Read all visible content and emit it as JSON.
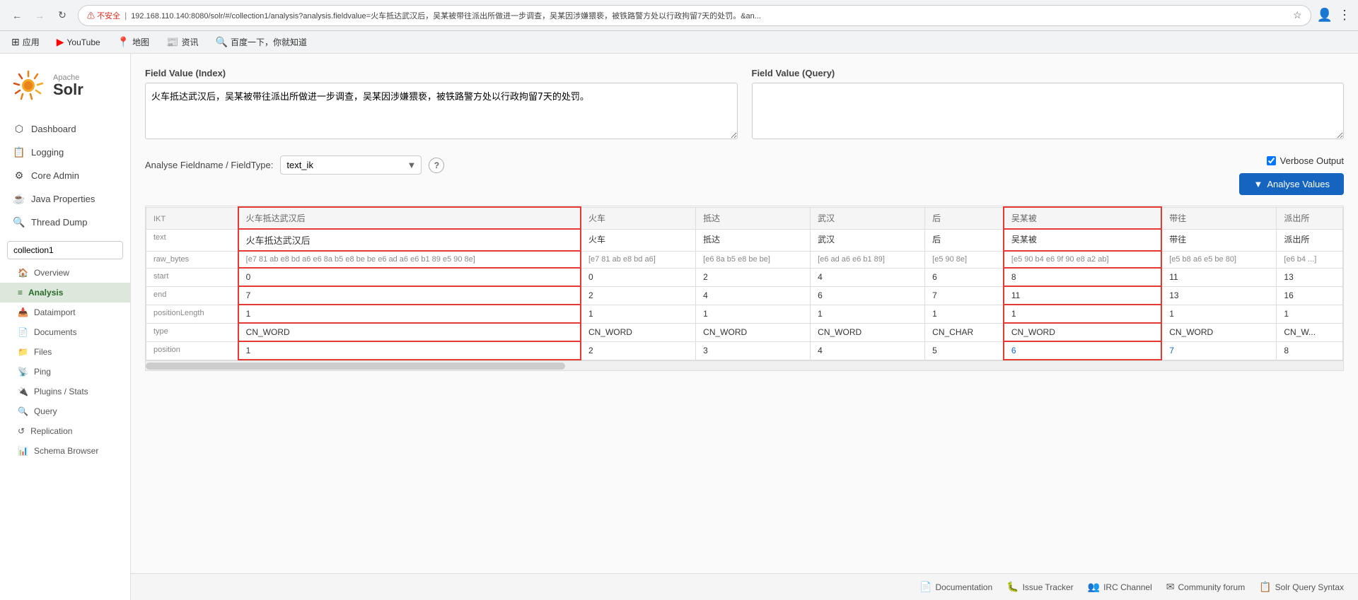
{
  "browser": {
    "url": "192.168.110.140:8080/solr/#/collection1/analysis?analysis.fieldvalue=火车抵达武汉后，吴某被带往派出所做进一步调查，吴某因涉嫌猥亵，被铁路警方处以行政拘留7天的处罚。&an...",
    "security_label": "不安全",
    "back_disabled": false,
    "forward_disabled": false
  },
  "bookmarks": [
    {
      "id": "apps",
      "label": "应用",
      "icon": "⊞"
    },
    {
      "id": "youtube",
      "label": "YouTube",
      "icon": "▶"
    },
    {
      "id": "maps",
      "label": "地图",
      "icon": "📍"
    },
    {
      "id": "news",
      "label": "资讯",
      "icon": "📰"
    },
    {
      "id": "baidu",
      "label": "百度一下，你就知道",
      "icon": "🔍"
    }
  ],
  "sidebar": {
    "logo_apache": "Apache",
    "logo_solr": "Solr",
    "nav_items": [
      {
        "id": "dashboard",
        "label": "Dashboard",
        "icon": "⬡"
      },
      {
        "id": "logging",
        "label": "Logging",
        "icon": "📋"
      },
      {
        "id": "core-admin",
        "label": "Core Admin",
        "icon": "⚙"
      },
      {
        "id": "java-properties",
        "label": "Java Properties",
        "icon": "☕"
      },
      {
        "id": "thread-dump",
        "label": "Thread Dump",
        "icon": "🔍"
      }
    ],
    "collection_selector": {
      "value": "collection1",
      "options": [
        "collection1"
      ]
    },
    "collection_nav": [
      {
        "id": "overview",
        "label": "Overview",
        "icon": "🏠"
      },
      {
        "id": "analysis",
        "label": "Analysis",
        "icon": "≡",
        "active": true
      },
      {
        "id": "dataimport",
        "label": "Dataimport",
        "icon": "📥"
      },
      {
        "id": "documents",
        "label": "Documents",
        "icon": "📄"
      },
      {
        "id": "files",
        "label": "Files",
        "icon": "📁"
      },
      {
        "id": "ping",
        "label": "Ping",
        "icon": "📡"
      },
      {
        "id": "plugins-stats",
        "label": "Plugins / Stats",
        "icon": "🔌"
      },
      {
        "id": "query",
        "label": "Query",
        "icon": "🔍"
      },
      {
        "id": "replication",
        "label": "Replication",
        "icon": "↺"
      },
      {
        "id": "schema-browser",
        "label": "Schema Browser",
        "icon": "📊"
      }
    ]
  },
  "main": {
    "field_value_index_label": "Field Value (Index)",
    "field_value_index_text": "火车抵达武汉后，吴某被带往派出所做进一步调查，吴某因涉嫌猥亵，被铁路警方处以行政拘留7天的处罚。",
    "field_value_query_label": "Field Value (Query)",
    "field_value_query_text": "",
    "analyse_label": "Analyse Fieldname / FieldType:",
    "fieldtype_value": "text_ik",
    "verbose_label": "Verbose Output",
    "verbose_checked": true,
    "analyse_btn_label": "Analyse Values",
    "table": {
      "row_labels": [
        "text",
        "raw_bytes",
        "start",
        "end",
        "positionLength",
        "type",
        "position"
      ],
      "columns": [
        {
          "ikt": "IKT",
          "header": "火车抵达武汉后",
          "highlighted": true,
          "text": "火车抵达武汉后",
          "raw_bytes": "[e7 81 ab e8 bd a6 e6 8a b5 e8 be be e6 ad a6 e6 b1 89 e5 90 8e]",
          "start": "0",
          "end": "7",
          "positionLength": "1",
          "type": "CN_WORD",
          "position": "1"
        },
        {
          "header": "火车",
          "text": "火车",
          "raw_bytes": "[e7 81 ab e8 bd a6]",
          "start": "0",
          "end": "2",
          "positionLength": "1",
          "type": "CN_WORD",
          "position": "2"
        },
        {
          "header": "抵达",
          "text": "抵达",
          "raw_bytes": "[e6 8a b5 e8 be be]",
          "start": "2",
          "end": "4",
          "positionLength": "1",
          "type": "CN_WORD",
          "position": "3"
        },
        {
          "header": "武汉",
          "text": "武汉",
          "raw_bytes": "[e6 ad a6 e6 b1 89]",
          "start": "4",
          "end": "6",
          "positionLength": "1",
          "type": "CN_WORD",
          "position": "4"
        },
        {
          "header": "后",
          "text": "后",
          "raw_bytes": "[e5 90 8e]",
          "start": "6",
          "end": "7",
          "positionLength": "1",
          "type": "CN_CHAR",
          "position": "5"
        },
        {
          "header": "吴某被",
          "highlighted": true,
          "text": "吴某被",
          "raw_bytes": "[e5 90 b4 e6 9f 90 e8 a2 ab]",
          "start": "8",
          "end": "11",
          "positionLength": "1",
          "type": "CN_WORD",
          "position": "6"
        },
        {
          "header": "带往",
          "text": "带往",
          "raw_bytes": "[e5 b8 a6 e5 be 80]",
          "start": "11",
          "end": "13",
          "positionLength": "1",
          "type": "CN_WORD",
          "position": "7",
          "link_position": true
        },
        {
          "header": "派出所",
          "text": "派出所",
          "raw_bytes": "[e6 b4 ...]",
          "start": "13",
          "end": "16",
          "positionLength": "1",
          "type": "CN_W...",
          "position": "8"
        }
      ]
    }
  },
  "footer": {
    "links": [
      {
        "id": "documentation",
        "label": "Documentation",
        "icon": "📄"
      },
      {
        "id": "issue-tracker",
        "label": "Issue Tracker",
        "icon": "🐛"
      },
      {
        "id": "irc-channel",
        "label": "IRC Channel",
        "icon": "👥"
      },
      {
        "id": "community-forum",
        "label": "Community forum",
        "icon": "✉"
      },
      {
        "id": "solr-query-syntax",
        "label": "Solr Query Syntax",
        "icon": "📋"
      }
    ]
  }
}
